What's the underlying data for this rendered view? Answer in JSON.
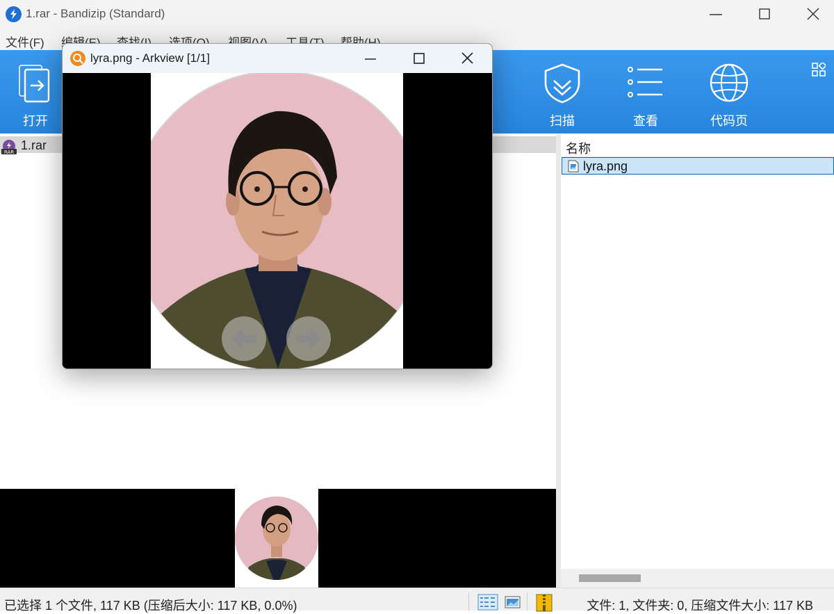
{
  "window": {
    "title": "1.rar - Bandizip (Standard)"
  },
  "menu": [
    "文件(F)",
    "编辑(E)",
    "查找(I)",
    "选项(O)",
    "视图(V)",
    "工具(T)",
    "帮助(H)"
  ],
  "toolbar": {
    "open_label": "打开",
    "scan_label": "扫描",
    "view_label": "查看",
    "codepage_label": "代码页"
  },
  "tree": {
    "archive": "1.rar"
  },
  "filelist": {
    "column_name": "名称",
    "files": [
      "lyra.png"
    ]
  },
  "arkview": {
    "title": "lyra.png - Arkview [1/1]"
  },
  "status": {
    "left": "已选择 1 个文件, 117 KB (压缩后大小: 117 KB, 0.0%)",
    "right": "文件: 1, 文件夹: 0, 压缩文件大小: 117 KB"
  },
  "colors": {
    "toolbar_blue": "#2f8fe6",
    "selection": "#cce4f7",
    "arkview_icon": "#f08a1c"
  }
}
